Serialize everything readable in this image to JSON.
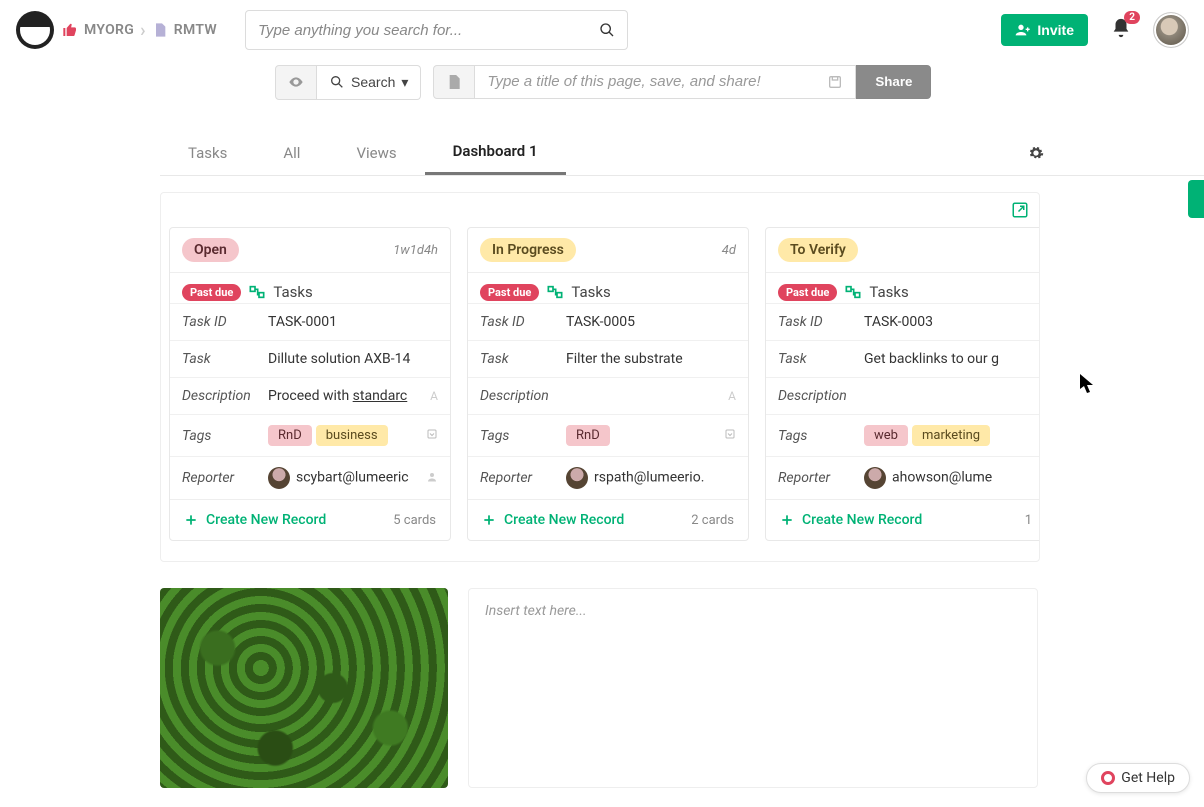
{
  "breadcrumb": {
    "org": "MYORG",
    "page": "RMTW"
  },
  "header": {
    "search_placeholder": "Type anything you search for...",
    "invite_label": "Invite",
    "notif_count": "2"
  },
  "toolbar": {
    "search_label": "Search",
    "title_placeholder": "Type a title of this page, save, and share!",
    "share_label": "Share"
  },
  "tabs": {
    "t0": "Tasks",
    "t1": "All",
    "t2": "Views",
    "t3": "Dashboard 1"
  },
  "board": {
    "past_due_label": "Past due",
    "tasks_label": "Tasks",
    "create_label": "Create New Record",
    "fields": {
      "task_id": "Task ID",
      "task": "Task",
      "description": "Description",
      "tags": "Tags",
      "reporter": "Reporter"
    },
    "columns": [
      {
        "title": "Open",
        "pill_class": "open",
        "meta": "1w1d4h",
        "task_id": "TASK-0001",
        "task": "Dillute solution AXB-14",
        "description_prefix": "Proceed with ",
        "description_underlined": "standarc",
        "tags": [
          {
            "label": "RnD",
            "cls": "tag-rnd"
          },
          {
            "label": "business",
            "cls": "tag-biz"
          }
        ],
        "reporter": "scybart@lumeeric",
        "cards": "5 cards"
      },
      {
        "title": "In Progress",
        "pill_class": "progress",
        "meta": "4d",
        "task_id": "TASK-0005",
        "task": "Filter the substrate",
        "description_prefix": "",
        "description_underlined": "",
        "tags": [
          {
            "label": "RnD",
            "cls": "tag-rnd"
          }
        ],
        "reporter": "rspath@lumeerio.",
        "cards": "2 cards"
      },
      {
        "title": "To Verify",
        "pill_class": "verify",
        "meta": "",
        "task_id": "TASK-0003",
        "task": "Get backlinks to our g",
        "description_prefix": "",
        "description_underlined": "",
        "tags": [
          {
            "label": "web",
            "cls": "tag-web"
          },
          {
            "label": "marketing",
            "cls": "tag-mkt"
          }
        ],
        "reporter": "ahowson@lume",
        "cards": "1"
      }
    ]
  },
  "text_widget_placeholder": "Insert text here...",
  "get_help_label": "Get Help"
}
